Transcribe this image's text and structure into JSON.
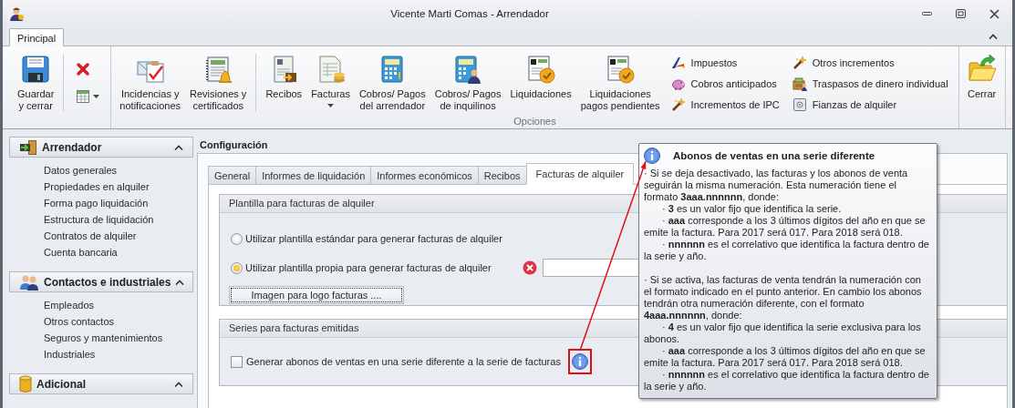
{
  "window": {
    "title": "Vicente Marti Comas - Arrendador"
  },
  "ribbon": {
    "tabs": [
      {
        "label": "Principal",
        "selected": true
      }
    ],
    "groups": [
      {
        "items": [
          {
            "kind": "large",
            "label": "Guardar\ny cerrar",
            "dropdown": false
          },
          {
            "kind": "separator"
          },
          {
            "kind": "icon_stack",
            "buttons": [
              {
                "dropdown": false
              },
              {
                "dropdown": true
              }
            ]
          }
        ]
      },
      {
        "label": "Opciones",
        "items": [
          {
            "kind": "large",
            "label": "Incidencias y\nnotificaciones",
            "dropdown": false
          },
          {
            "kind": "large",
            "label": "Revisiones y\ncertificados",
            "dropdown": false
          },
          {
            "kind": "separator"
          },
          {
            "kind": "large",
            "label": "Recibos",
            "dropdown": false
          },
          {
            "kind": "large",
            "label": "Facturas",
            "dropdown": true
          },
          {
            "kind": "large",
            "label": "Cobros/ Pagos\ndel arrendador",
            "dropdown": false
          },
          {
            "kind": "large",
            "label": "Cobros/ Pagos\nde inquilinos",
            "dropdown": false
          },
          {
            "kind": "large",
            "label": "Liquidaciones",
            "dropdown": false
          },
          {
            "kind": "large",
            "label": "Liquidaciones\npagos pendientes",
            "dropdown": false
          },
          {
            "kind": "small_stack",
            "buttons": [
              {
                "label": "Impuestos"
              },
              {
                "label": "Cobros anticipados"
              },
              {
                "label": "Incrementos de IPC"
              }
            ]
          },
          {
            "kind": "small_stack",
            "buttons": [
              {
                "label": "Otros incrementos"
              },
              {
                "label": "Traspasos de dinero individual"
              },
              {
                "label": "Fianzas de alquiler"
              }
            ]
          }
        ]
      },
      {
        "items": [
          {
            "kind": "large",
            "label": "Cerrar",
            "dropdown": false
          }
        ]
      }
    ]
  },
  "sidebar": {
    "sections": [
      {
        "title": "Arrendador",
        "expanded": true,
        "items": [
          {
            "label": "Datos generales"
          },
          {
            "label": "Propiedades en alquiler"
          },
          {
            "label": "Forma pago liquidación"
          },
          {
            "label": "Estructura de liquidación"
          },
          {
            "label": "Contratos de alquiler"
          },
          {
            "label": "Cuenta bancaria"
          }
        ]
      },
      {
        "title": "Contactos e industriales",
        "expanded": true,
        "items": [
          {
            "label": "Empleados"
          },
          {
            "label": "Otros contactos"
          },
          {
            "label": "Seguros y mantenimientos"
          },
          {
            "label": "Industriales"
          }
        ]
      },
      {
        "title": "Adicional",
        "expanded": true
      }
    ]
  },
  "configuration": {
    "title": "Configuración",
    "tabs": [
      {
        "label": "General",
        "selected": false
      },
      {
        "label": "Informes de liquidación",
        "selected": false
      },
      {
        "label": "Informes económicos",
        "selected": false
      },
      {
        "label": "Recibos",
        "selected": false
      },
      {
        "label": "Facturas de alquiler",
        "selected": true
      }
    ],
    "template_group": {
      "title": "Plantilla para facturas de alquiler",
      "options": [
        {
          "label": "Utilizar plantilla estándar para generar facturas de alquiler",
          "selected": false
        },
        {
          "label": "Utilizar plantilla propia para generar facturas de alquiler",
          "selected": true
        }
      ],
      "logo_button": "Imagen para logo facturas ...."
    },
    "series_group": {
      "title": "Series para facturas emitidas",
      "checkbox": {
        "label": "Generar abonos de ventas en una serie diferente a la serie de facturas",
        "checked": false
      }
    }
  },
  "tooltip": {
    "title": "Abonos de ventas en una serie diferente",
    "paragraphs": [
      {
        "text": "· Si se deja desactivado, las facturas y los abonos de venta seguirán la misma numeración. Esta numeración tiene el formato **3aaa.nnnnnn**, donde:",
        "children": [
          {
            "text": "· **3** es un valor fijo que identifica la serie."
          },
          {
            "text": "· **aaa** corresponde a los 3 últimos dígitos del año en que se emite la factura. Para 2017 será 017. Para 2018 será 018."
          },
          {
            "text": "· **nnnnnn** es el correlativo que identifica la factura dentro de la serie y año."
          }
        ]
      },
      {
        "text": "· Si se activa, las facturas de venta tendrán la numeración con el formato indicado en el punto anterior. En cambio los abonos tendrán otra numeración diferente, con el formato **4aaa.nnnnnn**, donde:",
        "children": [
          {
            "text": "· **4** es un valor fijo que identifica la serie exclusiva para los abonos."
          },
          {
            "text": "· **aaa** corresponde a los 3 últimos dígitos del año en que se emite la factura. Para 2017 será 017. Para 2018 será 018."
          },
          {
            "text": "· **nnnnnn** es el correlativo que identifica la factura dentro de la serie y año."
          }
        ]
      }
    ]
  }
}
